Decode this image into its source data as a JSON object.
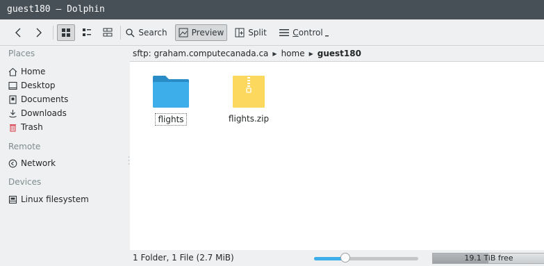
{
  "window": {
    "title": "guest180 — Dolphin"
  },
  "toolbar": {
    "back_icon": "chevron-left-icon",
    "forward_icon": "chevron-right-icon",
    "view_modes": [
      "icons-view-icon",
      "compact-view-icon",
      "details-view-icon"
    ],
    "search_label": "Search",
    "preview_label": "Preview",
    "split_label": "Split",
    "control_label": "Control"
  },
  "sidebar": {
    "places_title": "Places",
    "places": [
      {
        "label": "Home",
        "icon": "home-icon"
      },
      {
        "label": "Desktop",
        "icon": "desktop-icon"
      },
      {
        "label": "Documents",
        "icon": "documents-icon"
      },
      {
        "label": "Downloads",
        "icon": "downloads-icon"
      },
      {
        "label": "Trash",
        "icon": "trash-icon"
      }
    ],
    "remote_title": "Remote",
    "remote": [
      {
        "label": "Network",
        "icon": "network-icon"
      }
    ],
    "devices_title": "Devices",
    "devices": [
      {
        "label": "Linux filesystem",
        "icon": "drive-icon"
      }
    ]
  },
  "breadcrumb": {
    "items": [
      "sftp: graham.computecanada.ca",
      "home",
      "guest180"
    ]
  },
  "files": [
    {
      "name": "flights",
      "kind": "folder",
      "selected": true
    },
    {
      "name": "flights.zip",
      "kind": "archive",
      "selected": false
    }
  ],
  "status": {
    "summary": "1 Folder, 1 File (2.7 MiB)",
    "zoom_level": 0.3,
    "free_space": "19.1 TiB free",
    "used_fraction": 0.5
  },
  "colors": {
    "titlebar": "#475057",
    "accent": "#3daee9",
    "folder": "#3daee9",
    "archive": "#fdd85e",
    "trash": "#da4453"
  }
}
